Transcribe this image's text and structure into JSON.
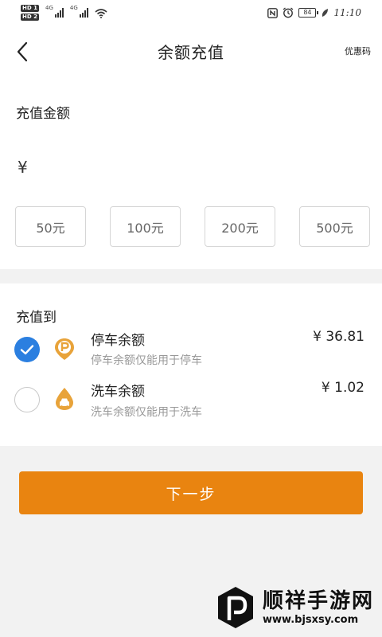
{
  "status_bar": {
    "sim_labels": [
      "HD 1",
      "HD 2"
    ],
    "network_labels": [
      "4G",
      "4G"
    ],
    "battery": "84",
    "time": "11:10",
    "icons": [
      "nfc-icon",
      "alarm-icon",
      "battery-icon",
      "leaf-icon",
      "wifi-icon"
    ]
  },
  "nav": {
    "title": "余额充值",
    "coupon": "优惠码"
  },
  "amount": {
    "label": "充值金额",
    "currency": "¥",
    "options": [
      "50元",
      "100元",
      "200元",
      "500元"
    ]
  },
  "target": {
    "label": "充值到",
    "accounts": [
      {
        "name": "停车余额",
        "desc": "停车余额仅能用于停车",
        "amount": "¥ 36.81",
        "checked": true,
        "icon": "parking-icon"
      },
      {
        "name": "洗车余额",
        "desc": "洗车余额仅能用于洗车",
        "amount": "¥ 1.02",
        "checked": false,
        "icon": "car-wash-icon"
      }
    ]
  },
  "next_button": "下一步",
  "watermark": {
    "name": "顺祥手游网",
    "url": "www.bjsxsy.com"
  },
  "colors": {
    "accent": "#e98410",
    "check_blue": "#2b7fe0",
    "icon_orange": "#e8a33a"
  }
}
